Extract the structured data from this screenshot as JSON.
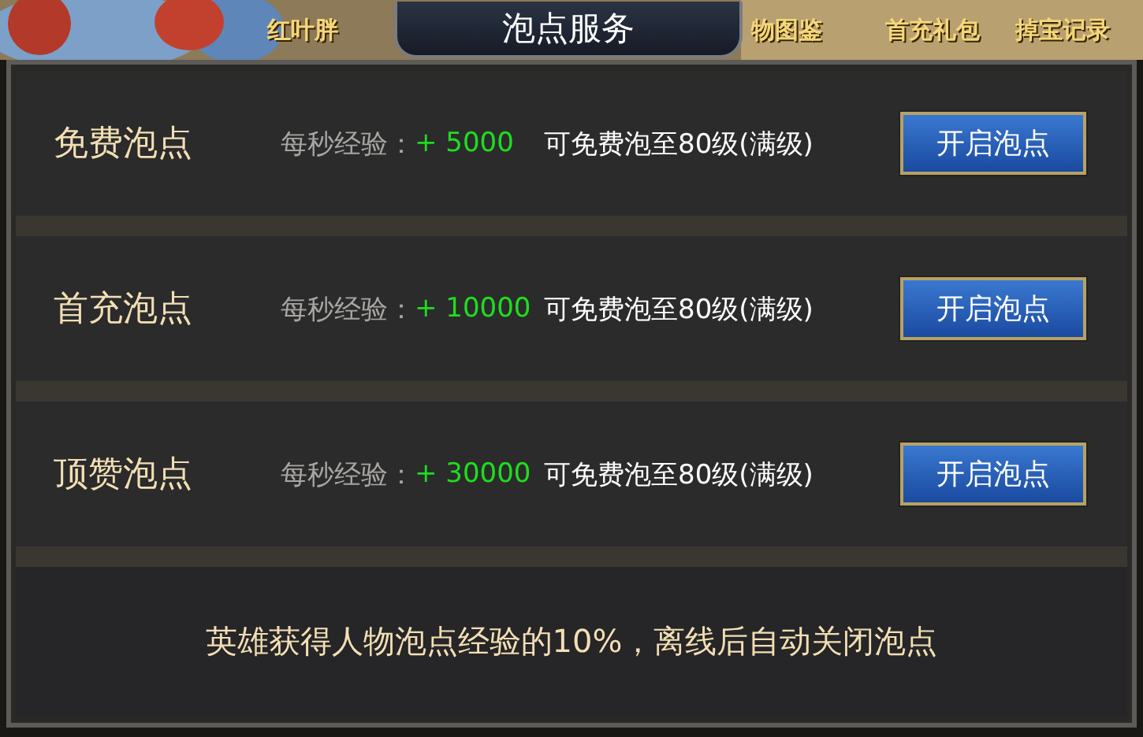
{
  "background_menu": [
    {
      "label": "红叶胖"
    },
    {
      "label": "物图鉴"
    },
    {
      "label": "首充礼包"
    },
    {
      "label": "掉宝记录"
    }
  ],
  "window": {
    "title": "泡点服务"
  },
  "rows": [
    {
      "name": "免费泡点",
      "exp_label": "每秒经验：",
      "exp_value": "+ 5000",
      "description": "可免费泡至80级(满级)",
      "button": "开启泡点"
    },
    {
      "name": "首充泡点",
      "exp_label": "每秒经验：",
      "exp_value": "+ 10000",
      "description": "可免费泡至80级(满级)",
      "button": "开启泡点"
    },
    {
      "name": "顶赞泡点",
      "exp_label": "每秒经验：",
      "exp_value": "+ 30000",
      "description": "可免费泡至80级(满级)",
      "button": "开启泡点"
    }
  ],
  "footer": "英雄获得人物泡点经验的10%，离线后自动关闭泡点"
}
